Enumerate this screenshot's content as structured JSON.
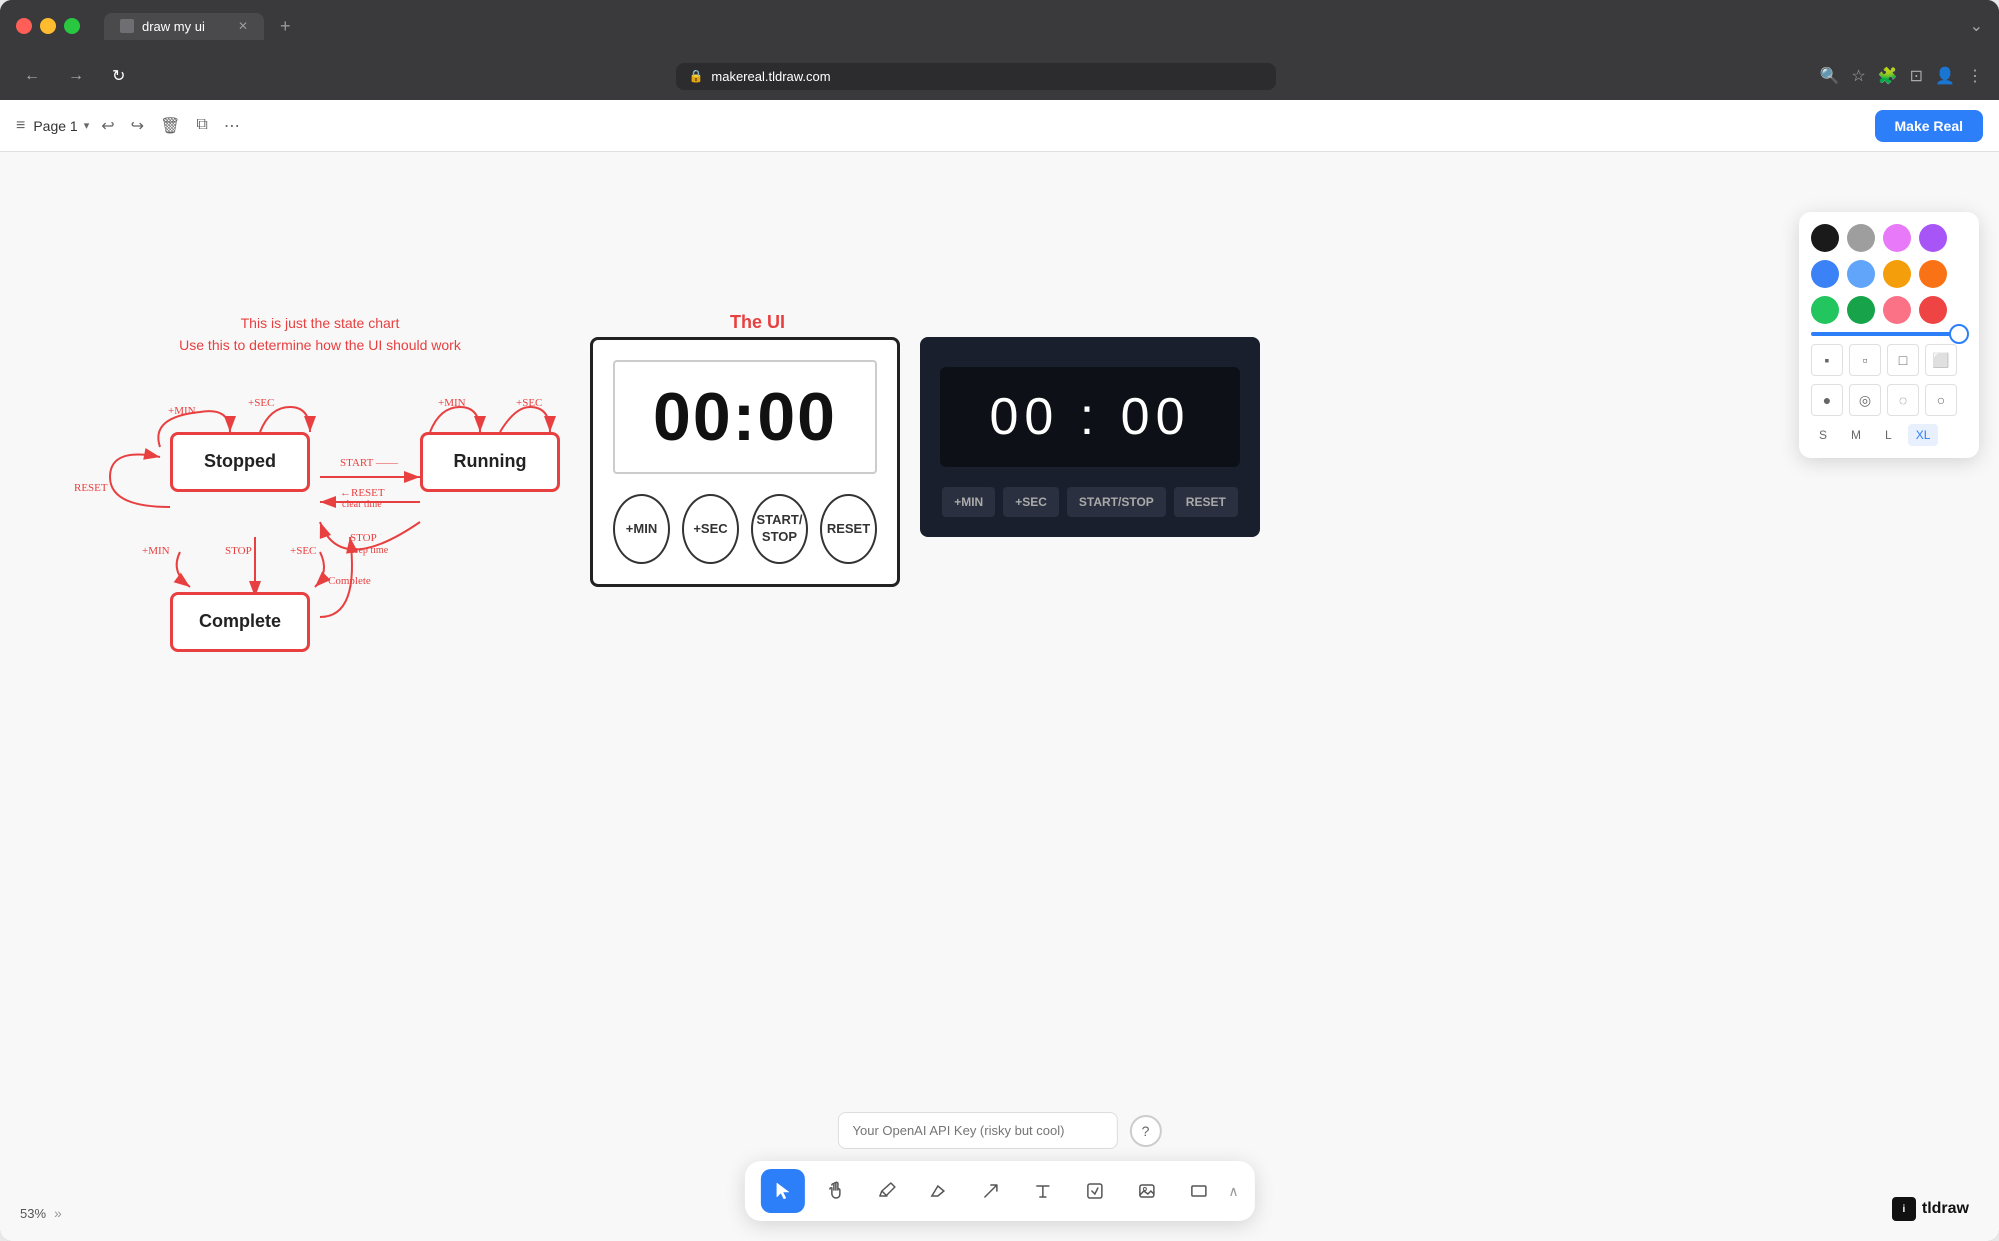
{
  "browser": {
    "tab_title": "draw my ui",
    "url": "makereal.tldraw.com",
    "tab_new": "+"
  },
  "toolbar": {
    "page_name": "Page 1",
    "make_real_label": "Make Real",
    "undo_label": "↩",
    "redo_label": "↪"
  },
  "color_panel": {
    "colors_row1": [
      "#1a1a1a",
      "#9e9e9e",
      "#e879f9",
      "#a855f7"
    ],
    "colors_row2": [
      "#3b82f6",
      "#60a5fa",
      "#f59e0b",
      "#f97316"
    ],
    "colors_row3": [
      "#22c55e",
      "#16a34a",
      "#fb7185",
      "#ef4444"
    ],
    "sizes": [
      "S",
      "M",
      "L",
      "XL"
    ],
    "active_size": "XL"
  },
  "state_chart": {
    "title_line1": "This is just the state chart",
    "title_line2": "Use this to determine how the UI should work",
    "stopped_label": "Stopped",
    "running_label": "Running",
    "complete_label": "Complete",
    "arrows": {
      "plus_min_top_left": "+MIN",
      "plus_sec_top_left": "+SEC",
      "plus_min_top_right": "+MIN",
      "plus_sec_top_right": "+SEC",
      "start_label": "START",
      "reset_left": "RESET",
      "reset_arrow": "RESET",
      "reset_clear": "clear time",
      "stop_label": "STOP",
      "stop_keep": "keep time",
      "plus_min_bottom": "+MIN",
      "stop_bottom": "STOP",
      "plus_sec_bottom": "+SEC",
      "complete_arrow": "Complete"
    }
  },
  "ui_label": "The UI",
  "timer_light": {
    "display": "00:00",
    "btn_min": "+MIN",
    "btn_sec": "+SEC",
    "btn_start_stop": "START/ STOP",
    "btn_reset": "RESET"
  },
  "timer_dark": {
    "display": "00 : 00",
    "btn_min": "+MIN",
    "btn_sec": "+SEC",
    "btn_start_stop": "START/STOP",
    "btn_reset": "RESET"
  },
  "bottom": {
    "api_placeholder": "Your OpenAI API Key (risky but cool)",
    "help_icon": "?",
    "tools": [
      "cursor",
      "hand",
      "pencil",
      "eraser",
      "arrow",
      "text",
      "edit",
      "image",
      "rectangle"
    ],
    "zoom": "53%"
  },
  "tldraw": {
    "logo_text": "tldraw",
    "logo_icon": "i"
  }
}
